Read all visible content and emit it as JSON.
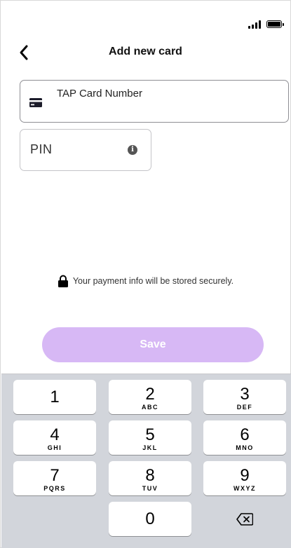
{
  "header": {
    "title": "Add new card"
  },
  "form": {
    "card_number_label": "TAP Card Number",
    "pin_label": "PIN",
    "info_glyph": "i"
  },
  "secure_note": {
    "text": "Your payment info will be stored securely."
  },
  "save_button": {
    "label": "Save",
    "color": "#d7b8f5"
  },
  "keypad": {
    "keys": [
      {
        "digit": "1",
        "letters": ""
      },
      {
        "digit": "2",
        "letters": "ABC"
      },
      {
        "digit": "3",
        "letters": "DEF"
      },
      {
        "digit": "4",
        "letters": "GHI"
      },
      {
        "digit": "5",
        "letters": "JKL"
      },
      {
        "digit": "6",
        "letters": "MNO"
      },
      {
        "digit": "7",
        "letters": "PQRS"
      },
      {
        "digit": "8",
        "letters": "TUV"
      },
      {
        "digit": "9",
        "letters": "WXYZ"
      },
      {
        "digit": "0",
        "letters": ""
      }
    ]
  },
  "icons": {
    "back": "chevron-left-icon",
    "card": "credit-card-icon",
    "info": "info-icon",
    "lock": "lock-icon",
    "delete": "backspace-icon",
    "signal": "signal-icon",
    "battery": "battery-icon"
  }
}
